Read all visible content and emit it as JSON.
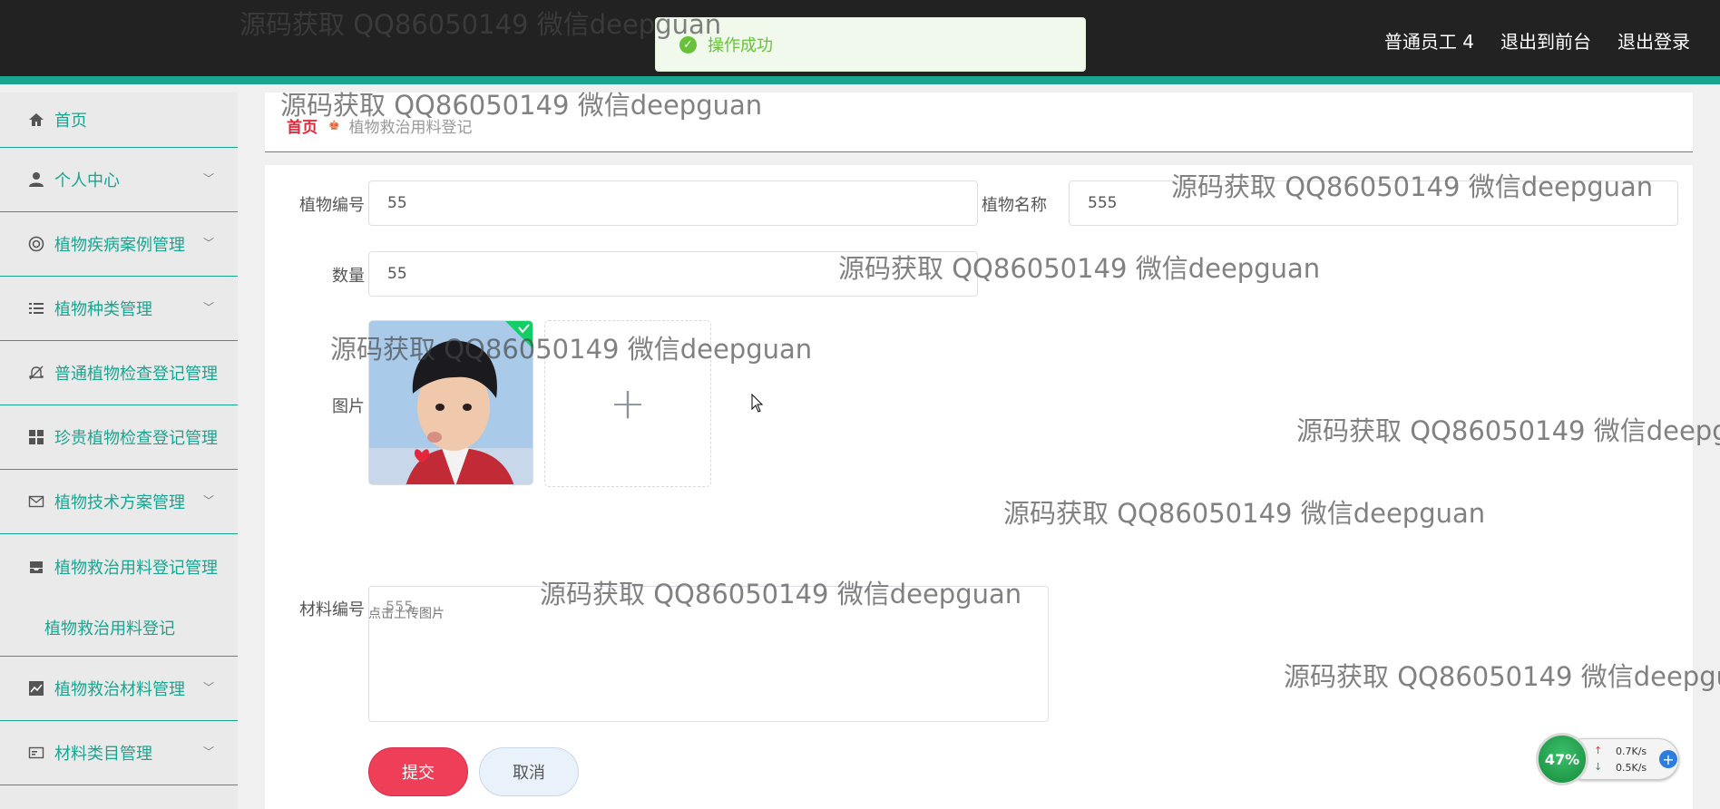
{
  "header": {
    "nav": [
      "普通员工 4",
      "退出到前台",
      "退出登录"
    ]
  },
  "toast": {
    "message": "操作成功"
  },
  "sidebar": {
    "items": [
      {
        "label": "首页",
        "icon": "home-icon"
      },
      {
        "label": "个人中心",
        "icon": "user-icon"
      },
      {
        "label": "植物疾病案例管理",
        "icon": "lifebuoy-icon"
      },
      {
        "label": "植物种类管理",
        "icon": "list-icon"
      },
      {
        "label": "普通植物检查登记管理",
        "icon": "bell-off-icon"
      },
      {
        "label": "珍贵植物检查登记管理",
        "icon": "grid-icon"
      },
      {
        "label": "植物技术方案管理",
        "icon": "mail-icon"
      },
      {
        "label": "植物救治用料登记管理",
        "icon": "drawer-icon"
      },
      {
        "label": "植物救治材料管理",
        "icon": "chart-icon"
      },
      {
        "label": "材料类目管理",
        "icon": "card-icon"
      }
    ],
    "active_sub": "植物救治用料登记"
  },
  "breadcrumb": {
    "home": "首页",
    "current": "植物救治用料登记"
  },
  "form": {
    "plant_no_label": "植物编号",
    "plant_no_value": "55",
    "plant_name_label": "植物名称",
    "plant_name_value": "555",
    "quantity_label": "数量",
    "quantity_value": "55",
    "image_label": "图片",
    "upload_hint": "点击上传图片",
    "material_no_label": "材料编号",
    "material_no_value": "555",
    "submit": "提交",
    "cancel": "取消"
  },
  "watermark": "源码获取 QQ86050149 微信deepguan",
  "speed": {
    "percent": "47%",
    "up": "0.7K/s",
    "down": "0.5K/s"
  }
}
